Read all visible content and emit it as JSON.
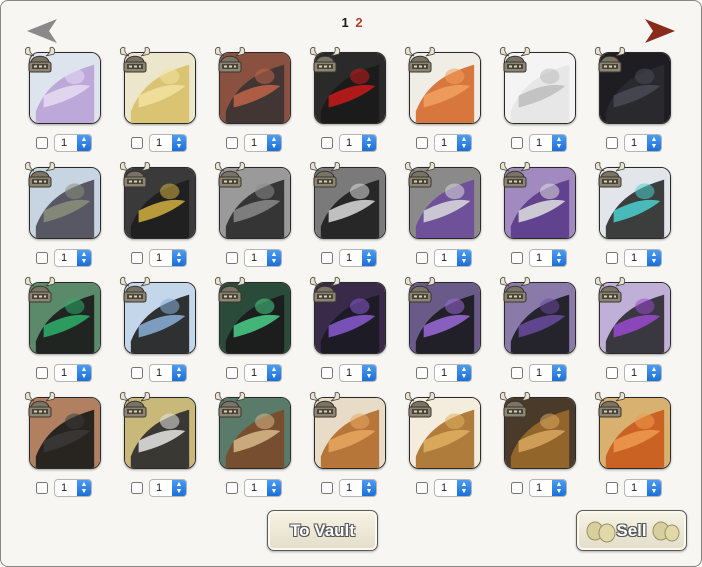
{
  "pagination": {
    "current": "1",
    "next": "2"
  },
  "items": [
    {
      "name": "lavender-ribbon",
      "c1": "#b8a2d6",
      "c2": "#e6dcf2",
      "bg": "#dde4ee"
    },
    {
      "name": "gold-band",
      "c1": "#d8c06a",
      "c2": "#f2e3a0",
      "bg": "#ece6cc"
    },
    {
      "name": "red-claws",
      "c1": "#3a3333",
      "c2": "#c0644a",
      "bg": "#8a5040"
    },
    {
      "name": "red-markings",
      "c1": "#1a1a1a",
      "c2": "#c81a1a",
      "bg": "#2a2a2a"
    },
    {
      "name": "amber-beads",
      "c1": "#d56a2a",
      "c2": "#f2a060",
      "bg": "#f0ece6"
    },
    {
      "name": "white-hood",
      "c1": "#e6e6e6",
      "c2": "#bcbcbc",
      "bg": "#f4f4f4"
    },
    {
      "name": "black-hood",
      "c1": "#2a2a30",
      "c2": "#4a4a55",
      "bg": "#1e1e22"
    },
    {
      "name": "horned-helm",
      "c1": "#4a4a55",
      "c2": "#8a8f7a",
      "bg": "#c7d4e2"
    },
    {
      "name": "gold-collar",
      "c1": "#1e1e1e",
      "c2": "#d4b040",
      "bg": "#3a3a3a"
    },
    {
      "name": "crow-mask",
      "c1": "#2a2a2a",
      "c2": "#8a8a8a",
      "bg": "#9a9a9a"
    },
    {
      "name": "skull-feathers",
      "c1": "#1e1e1e",
      "c2": "#dcdcdc",
      "bg": "#7a7a7a"
    },
    {
      "name": "purple-skull",
      "c1": "#6a4a9a",
      "c2": "#dcdcdc",
      "bg": "#8a8a8a"
    },
    {
      "name": "violet-skulls",
      "c1": "#5a3a8a",
      "c2": "#e0e0e0",
      "bg": "#a08ac0"
    },
    {
      "name": "teal-scarf",
      "c1": "#2a2a2a",
      "c2": "#4ad0d0",
      "bg": "#e2e6ea"
    },
    {
      "name": "green-drape",
      "c1": "#1a1a1a",
      "c2": "#2fb06a",
      "bg": "#5a8a6a"
    },
    {
      "name": "feather-necklace",
      "c1": "#1e1e1e",
      "c2": "#8ab0d8",
      "bg": "#c4d6ea"
    },
    {
      "name": "green-sash",
      "c1": "#1a1a1a",
      "c2": "#4ad08a",
      "bg": "#2a4a3a"
    },
    {
      "name": "shadow-purple",
      "c1": "#1a1a22",
      "c2": "#8a5ad0",
      "bg": "#3a2a4a"
    },
    {
      "name": "shadow-armor",
      "c1": "#1a1a1e",
      "c2": "#9a6ad8",
      "bg": "#6a5a8a"
    },
    {
      "name": "dark-spikes",
      "c1": "#1a1a1e",
      "c2": "#6a4aa0",
      "bg": "#8a7aaa"
    },
    {
      "name": "horned-beast",
      "c1": "#2a2a30",
      "c2": "#9a4ad0",
      "bg": "#c0b0d8"
    },
    {
      "name": "black-cloak",
      "c1": "#1a1a1a",
      "c2": "#3a3a3a",
      "bg": "#b08060"
    },
    {
      "name": "spectacles",
      "c1": "#2a2a2a",
      "c2": "#e6e6e6",
      "bg": "#c8b87a"
    },
    {
      "name": "wolf-mask",
      "c1": "#7a4a2a",
      "c2": "#d8b88a",
      "bg": "#5a7a6a"
    },
    {
      "name": "bronze-armor",
      "c1": "#b06a2a",
      "c2": "#e8a860",
      "bg": "#e8dcc8"
    },
    {
      "name": "bronze-gauntlet",
      "c1": "#a8702a",
      "c2": "#e0b060",
      "bg": "#f4ecdc"
    },
    {
      "name": "bronze-plate",
      "c1": "#9a6a2a",
      "c2": "#d8a860",
      "bg": "#4a3a2a"
    },
    {
      "name": "orange-tail",
      "c1": "#c85a1a",
      "c2": "#f09a50",
      "bg": "#d8b070"
    }
  ],
  "quantity": "1",
  "buttons": {
    "vault": "To Vault",
    "sell": "Sell"
  },
  "colors": {
    "arrow_left": "#8a8a8a",
    "arrow_right": "#8a2a1a",
    "stepper": "#2d7fe0"
  }
}
